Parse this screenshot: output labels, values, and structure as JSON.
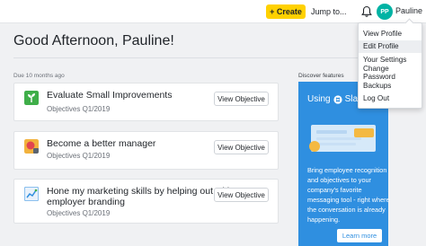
{
  "topbar": {
    "create_label": "+ Create",
    "jump_to_label": "Jump to...",
    "avatar_initials": "PP",
    "user_name": "Pauline"
  },
  "greeting": "Good Afternoon, Pauline!",
  "due_label": "Due 10 months ago",
  "discover_label": "Discover features",
  "objectives": [
    {
      "title": "Evaluate Small Improvements",
      "subtitle": "Objectives Q1/2019",
      "button": "View Objective",
      "icon_color": "#3fae49"
    },
    {
      "title": "Become a better manager",
      "subtitle": "Objectives Q1/2019",
      "button": "View Objective",
      "icon_color": "#e2444e"
    },
    {
      "title": "Hone my marketing skills by helping out with employer branding",
      "subtitle": "Objectives Q1/2019",
      "button": "View Objective",
      "icon_color": "#2f8fe0"
    }
  ],
  "promo": {
    "heading": "Using",
    "brand": "Slack",
    "text": "Bring employee recognition and objectives to your company's favorite messaging tool - right where the conversation is already happening.",
    "button": "Learn more",
    "bg_color": "#2f8fe0"
  },
  "profile_menu": {
    "items": [
      "View Profile",
      "Edit Profile",
      "Your Settings",
      "Change Password",
      "Backups",
      "Log Out"
    ],
    "highlighted_index": 1
  },
  "colors": {
    "accent_yellow": "#ffd100",
    "avatar": "#00b3a4"
  }
}
